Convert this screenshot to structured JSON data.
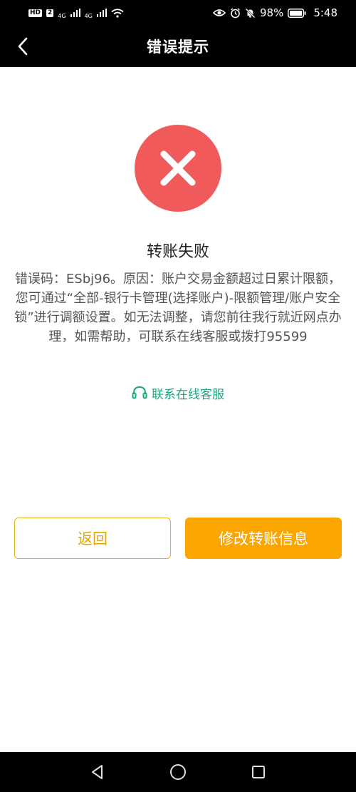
{
  "status_bar": {
    "hd_label": "HD",
    "hd_sim": "2",
    "net1": "4G",
    "net2": "4G",
    "battery_pct": "98%",
    "time": "5:48"
  },
  "header": {
    "title": "错误提示"
  },
  "result": {
    "title": "转账失败",
    "message": "错误码：ESbj96。原因：账户交易金额超过日累计限额，您可通过“全部-银行卡管理(选择账户)-限额管理/账户安全锁”进行调额设置。如无法调整，请您前往我行就近网点办理，如需帮助，可联系在线客服或拨打95599"
  },
  "contact": {
    "label": "联系在线客服"
  },
  "buttons": {
    "back_label": "返回",
    "modify_label": "修改转账信息"
  },
  "icons": {
    "back": "chevron-left-icon",
    "error": "close-icon",
    "contact": "headset-icon",
    "nav_back": "triangle-back-icon",
    "nav_home": "circle-home-icon",
    "nav_recent": "square-recent-icon"
  },
  "colors": {
    "header_bg": "#000000",
    "error_red": "#f05a5a",
    "accent_green": "#1aa77f",
    "primary_orange": "#fba600",
    "outline_yellow": "#e5b312"
  }
}
